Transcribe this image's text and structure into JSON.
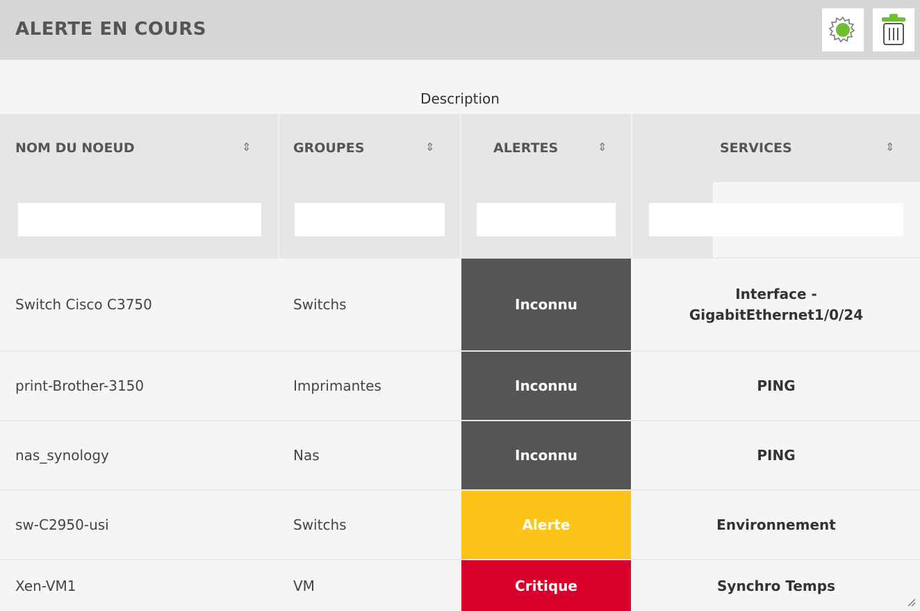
{
  "header": {
    "title": "ALERTE EN COURS",
    "icons": {
      "settings": "gear-icon",
      "delete": "trash-icon"
    },
    "accent_green": "#6dbf2f"
  },
  "table": {
    "caption": "Description",
    "columns": [
      {
        "label": "NOM DU NOEUD",
        "sort": "⇕"
      },
      {
        "label": "GROUPES",
        "sort": "⇕"
      },
      {
        "label": "ALERTES",
        "sort": "⇕"
      },
      {
        "label": "SERVICES",
        "sort": "⇕"
      }
    ],
    "filters": [
      "",
      "",
      "",
      ""
    ],
    "rows": [
      {
        "node": "Switch Cisco C3750",
        "group": "Switchs",
        "alert": "Inconnu",
        "alert_color": "#555555",
        "service": "Interface - GigabitEthernet1/0/24"
      },
      {
        "node": "print-Brother-3150",
        "group": "Imprimantes",
        "alert": "Inconnu",
        "alert_color": "#555555",
        "service": "PING"
      },
      {
        "node": "nas_synology",
        "group": "Nas",
        "alert": "Inconnu",
        "alert_color": "#555555",
        "service": "PING"
      },
      {
        "node": "sw-C2950-usi",
        "group": "Switchs",
        "alert": "Alerte",
        "alert_color": "#fcc419",
        "service": "Environnement"
      },
      {
        "node": "Xen-VM1",
        "group": "VM",
        "alert": "Critique",
        "alert_color": "#d6002a",
        "service": "Synchro Temps"
      }
    ]
  }
}
